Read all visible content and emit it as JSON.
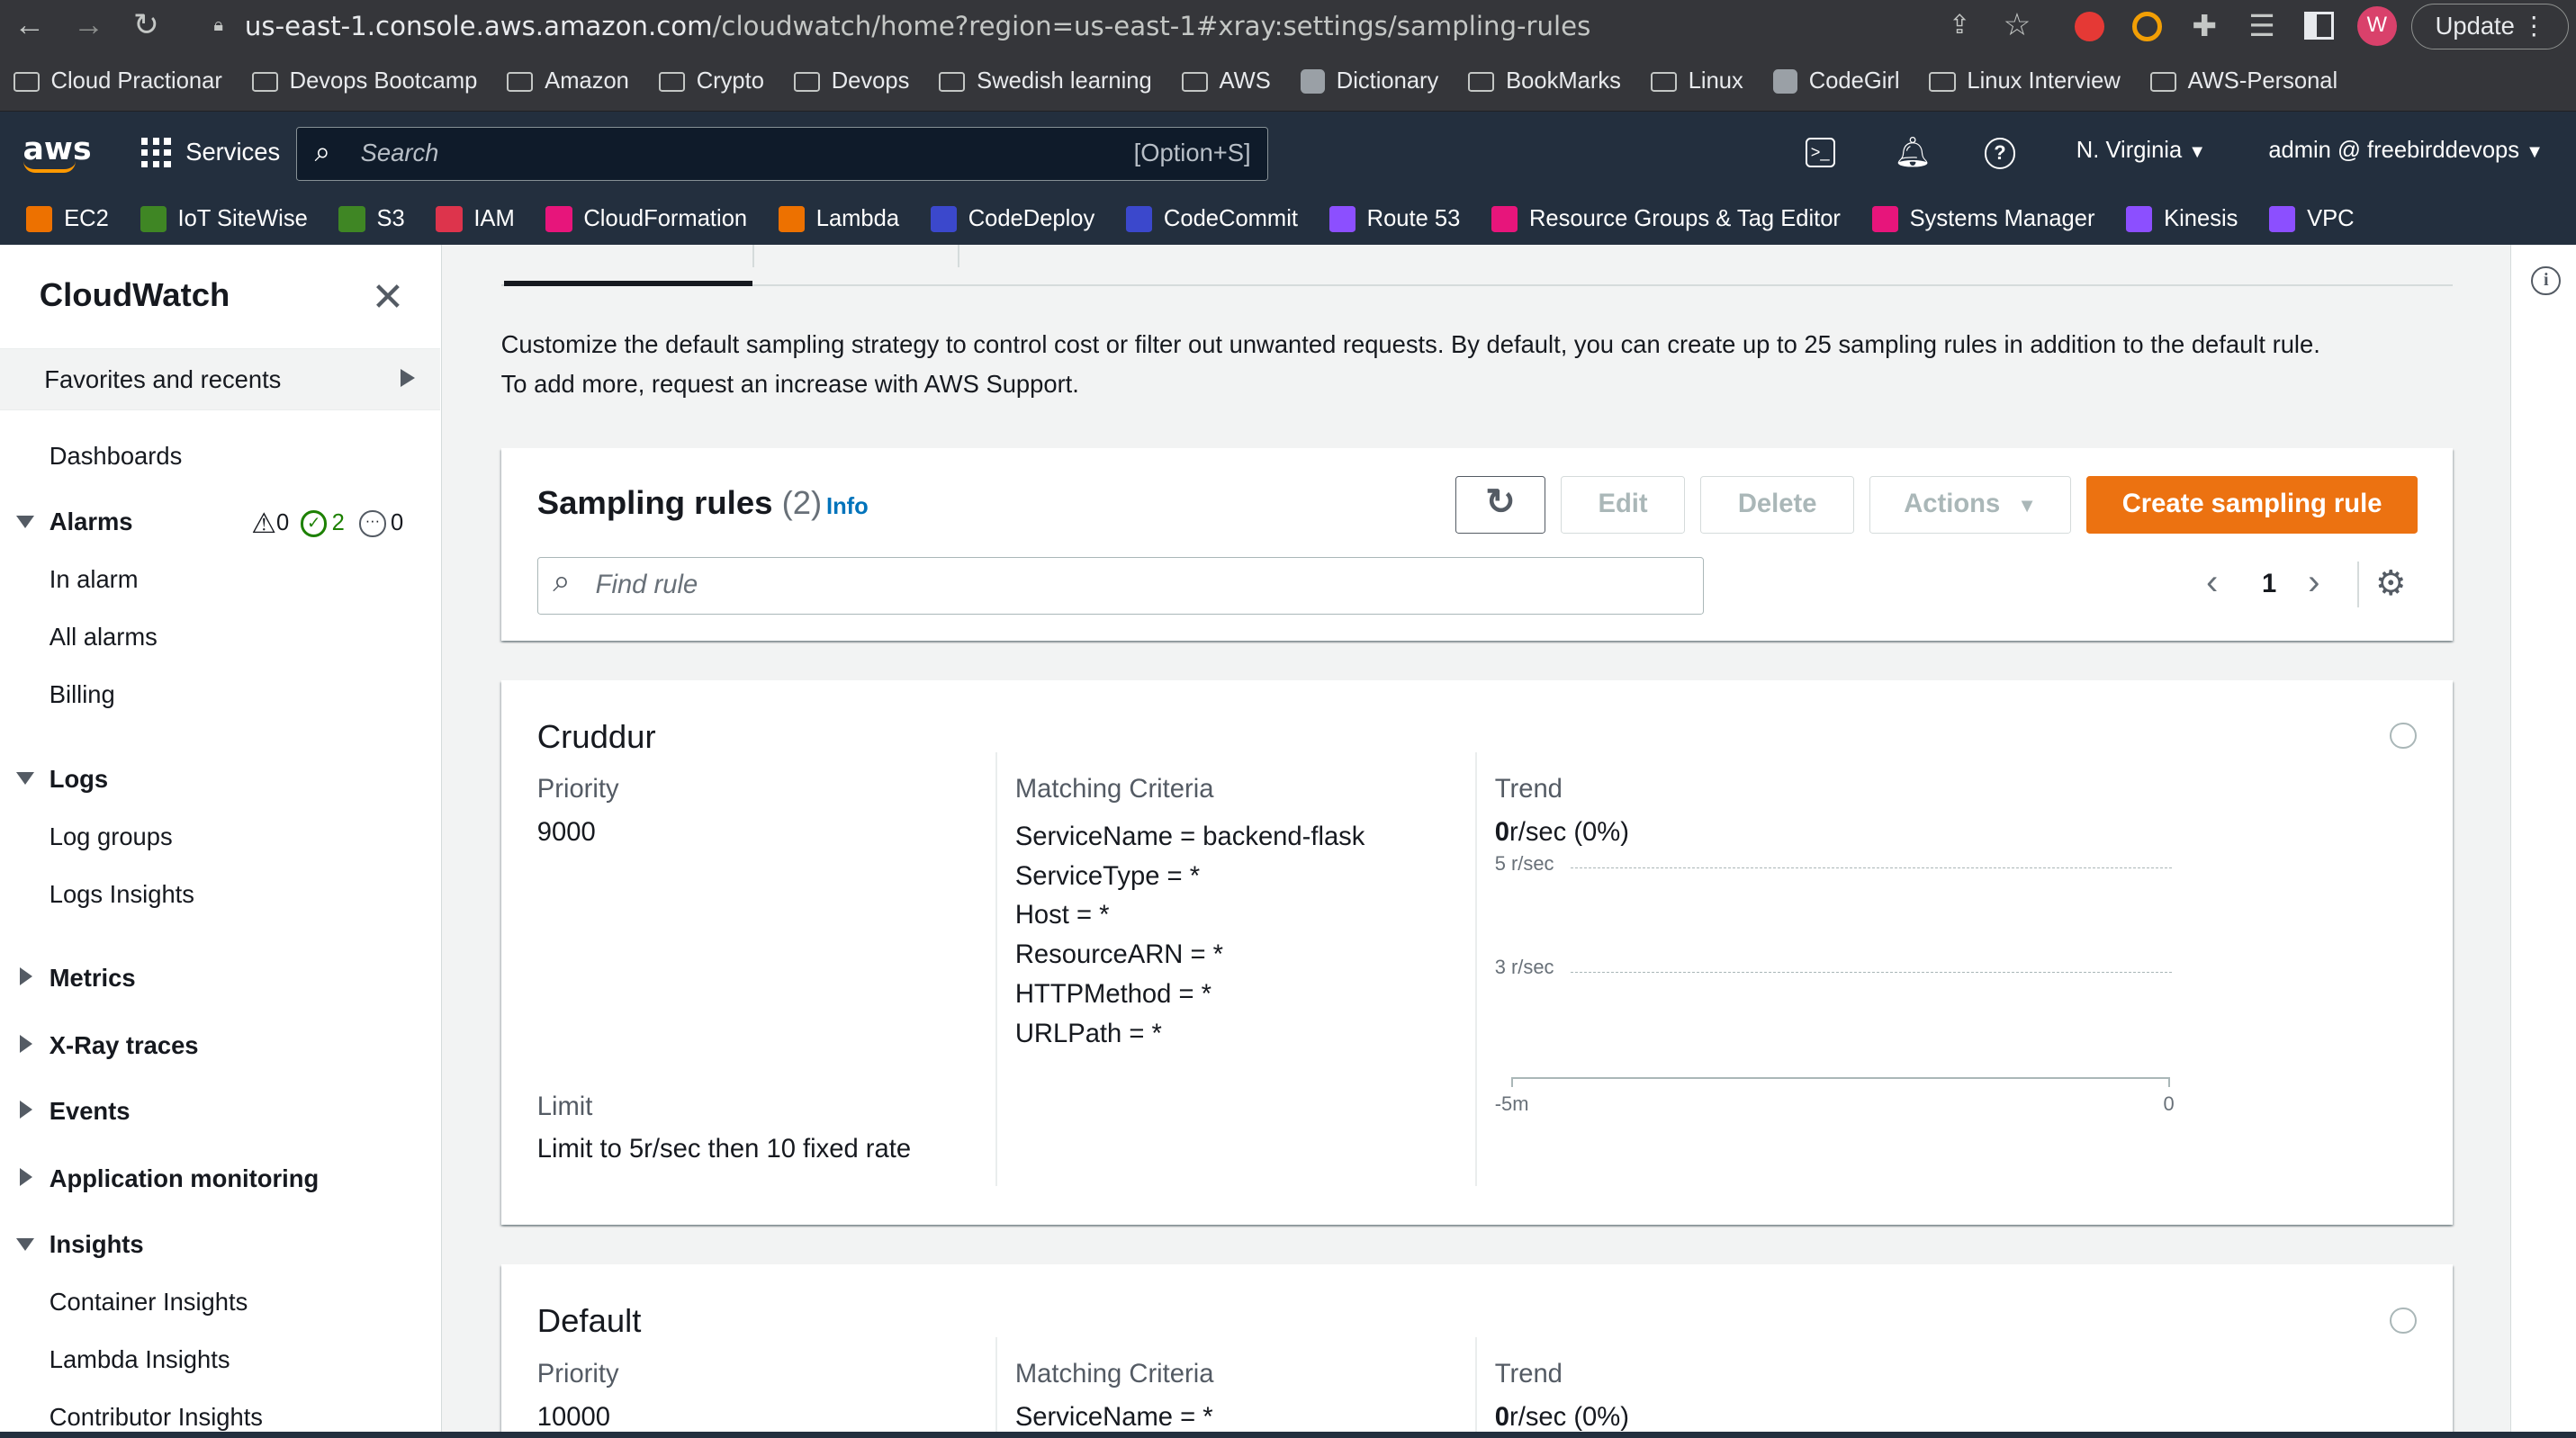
{
  "browser": {
    "url_host": "us-east-1.console.aws.amazon.com",
    "url_path": "/cloudwatch/home?region=us-east-1#xray:settings/sampling-rules",
    "profile_initial": "W",
    "update_label": "Update",
    "bookmarks": [
      "Cloud Practionar",
      "Devops Bootcamp",
      "Amazon",
      "Crypto",
      "Devops",
      "Swedish learning",
      "AWS",
      "Dictionary",
      "BookMarks",
      "Linux",
      "CodeGirl",
      "Linux Interview",
      "AWS-Personal"
    ]
  },
  "aws": {
    "logo": "aws",
    "services_label": "Services",
    "search_placeholder": "Search",
    "search_shortcut": "[Option+S]",
    "region": "N. Virginia",
    "account": "admin @ freebirddevops",
    "favorites": [
      {
        "label": "EC2",
        "color": "#ed7100"
      },
      {
        "label": "IoT SiteWise",
        "color": "#3f8624"
      },
      {
        "label": "S3",
        "color": "#3f8624"
      },
      {
        "label": "IAM",
        "color": "#dd344c"
      },
      {
        "label": "CloudFormation",
        "color": "#e7157b"
      },
      {
        "label": "Lambda",
        "color": "#ed7100"
      },
      {
        "label": "CodeDeploy",
        "color": "#3b48cc"
      },
      {
        "label": "CodeCommit",
        "color": "#3b48cc"
      },
      {
        "label": "Route 53",
        "color": "#8c4fff"
      },
      {
        "label": "Resource Groups & Tag Editor",
        "color": "#e7157b"
      },
      {
        "label": "Systems Manager",
        "color": "#e7157b"
      },
      {
        "label": "Kinesis",
        "color": "#8c4fff"
      },
      {
        "label": "VPC",
        "color": "#8c4fff"
      }
    ]
  },
  "sidebar": {
    "title": "CloudWatch",
    "favorites": "Favorites and recents",
    "dashboards": "Dashboards",
    "alarms": "Alarms",
    "alarm_counts": {
      "alarm": "0",
      "ok": "2",
      "insufficient": "0"
    },
    "in_alarm": "In alarm",
    "all_alarms": "All alarms",
    "billing": "Billing",
    "logs": "Logs",
    "log_groups": "Log groups",
    "logs_insights": "Logs Insights",
    "metrics": "Metrics",
    "xray": "X-Ray traces",
    "events": "Events",
    "app_monitoring": "Application monitoring",
    "insights": "Insights",
    "container_insights": "Container Insights",
    "lambda_insights": "Lambda Insights",
    "contributor_insights": "Contributor Insights"
  },
  "main": {
    "description_1": "Customize the default sampling strategy to control cost or filter out unwanted requests. By default, you can create up to 25 sampling rules in addition to the default rule.",
    "description_2": "To add more, request an increase with AWS Support.",
    "header_title": "Sampling rules",
    "header_count": "(2)",
    "info": "Info",
    "edit": "Edit",
    "delete": "Delete",
    "actions": "Actions",
    "create": "Create sampling rule",
    "find_placeholder": "Find rule",
    "page": "1",
    "rules": [
      {
        "name": "Cruddur",
        "priority_label": "Priority",
        "priority": "9000",
        "limit_label": "Limit",
        "limit": "Limit to 5r/sec then 10 fixed rate",
        "criteria_label": "Matching Criteria",
        "criteria": [
          "ServiceName = backend-flask",
          "ServiceType = *",
          "Host = *",
          "ResourceARN = *",
          "HTTPMethod = *",
          "URLPath = *"
        ],
        "trend_label": "Trend",
        "trend_value": "0",
        "trend_unit": "r/sec (0%)",
        "axis_y": [
          "5 r/sec",
          "3 r/sec"
        ],
        "axis_x": [
          "-5m",
          "0"
        ]
      },
      {
        "name": "Default",
        "priority_label": "Priority",
        "priority": "10000",
        "criteria_label": "Matching Criteria",
        "criteria_first": "ServiceName = *",
        "trend_label": "Trend",
        "trend_value": "0",
        "trend_unit": "r/sec (0%)"
      }
    ]
  }
}
